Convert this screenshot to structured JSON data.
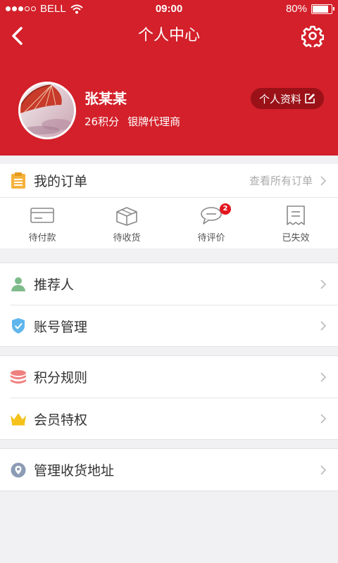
{
  "status_bar": {
    "carrier": "BELL",
    "time": "09:00",
    "battery": "80%",
    "battery_level": 0.8
  },
  "nav": {
    "title": "个人中心"
  },
  "profile": {
    "name": "张某某",
    "points": "26积分",
    "level": "银牌代理商",
    "edit_label": "个人资料"
  },
  "orders": {
    "title": "我的订单",
    "view_all": "查看所有订单",
    "items": [
      {
        "label": "待付款",
        "icon": "wallet-card-icon"
      },
      {
        "label": "待收货",
        "icon": "package-box-icon"
      },
      {
        "label": "待评价",
        "icon": "comment-bubble-icon",
        "badge": "2"
      },
      {
        "label": "已失效",
        "icon": "receipt-icon"
      }
    ]
  },
  "menu_groups": [
    [
      {
        "label": "推荐人",
        "icon": "person-icon",
        "color": "#7dbb8a"
      },
      {
        "label": "账号管理",
        "icon": "shield-check-icon",
        "color": "#5fb6ec"
      }
    ],
    [
      {
        "label": "积分规则",
        "icon": "coin-stack-icon",
        "color": "#f08080"
      },
      {
        "label": "会员特权",
        "icon": "crown-icon",
        "color": "#f5c21b"
      }
    ],
    [
      {
        "label": "管理收货地址",
        "icon": "location-pin-icon",
        "color": "#8c9bb5"
      }
    ]
  ],
  "colors": {
    "brand_red": "#d3202a",
    "badge_red": "#e4151e"
  }
}
